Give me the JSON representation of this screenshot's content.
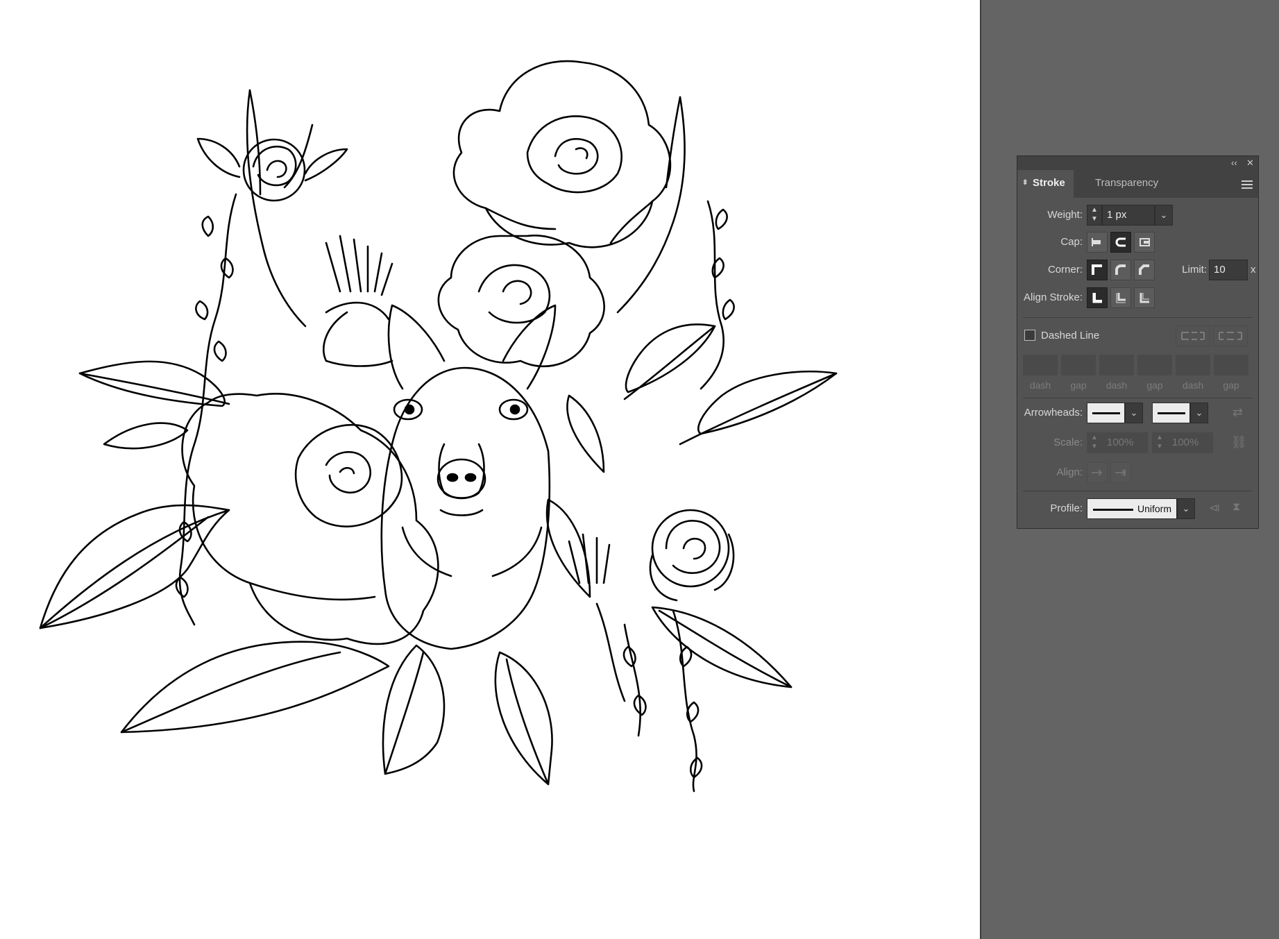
{
  "panel": {
    "collapse_icon": "‹‹",
    "close_icon": "✕",
    "tabs": [
      {
        "label": "Stroke",
        "active": true
      },
      {
        "label": "Transparency",
        "active": false
      }
    ],
    "weight": {
      "label": "Weight:",
      "value": "1 px"
    },
    "cap": {
      "label": "Cap:",
      "options": [
        "butt-cap",
        "round-cap",
        "projecting-cap"
      ],
      "selected": "round-cap"
    },
    "corner": {
      "label": "Corner:",
      "options": [
        "miter-join",
        "round-join",
        "bevel-join"
      ],
      "selected": "miter-join"
    },
    "limit": {
      "label": "Limit:",
      "value": "10",
      "suffix": "x"
    },
    "align_stroke": {
      "label": "Align Stroke:",
      "options": [
        "align-center",
        "align-inside",
        "align-outside"
      ],
      "selected": "align-center"
    },
    "dashed_line": {
      "label": "Dashed Line",
      "checked": false
    },
    "dash_fields": [
      "dash",
      "gap",
      "dash",
      "gap",
      "dash",
      "gap"
    ],
    "arrowheads": {
      "label": "Arrowheads:"
    },
    "scale": {
      "label": "Scale:",
      "start": "100%",
      "end": "100%"
    },
    "align": {
      "label": "Align:"
    },
    "profile": {
      "label": "Profile:",
      "value": "Uniform"
    }
  },
  "colors": {
    "pasteboard": "#646464",
    "panel_bg": "#535353",
    "tab_bar": "#424242",
    "artboard": "#ffffff"
  }
}
